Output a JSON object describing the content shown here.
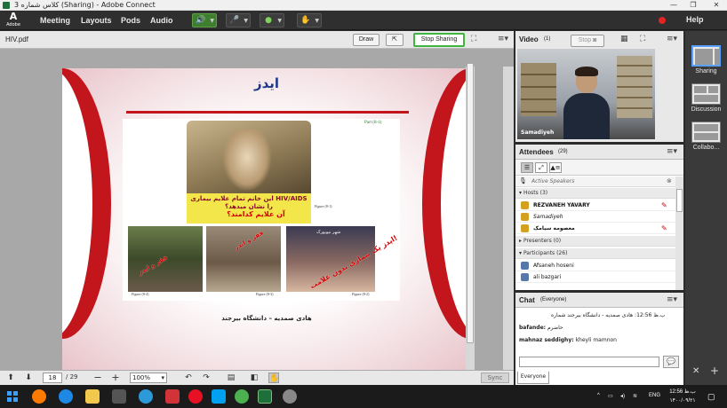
{
  "window": {
    "title": "کلاس شماره 3 (Sharing) - Adobe Connect",
    "controls": [
      "—",
      "❐",
      "✕"
    ]
  },
  "menubar": {
    "logo_text": "Adobe",
    "items": [
      "Meeting",
      "Layouts",
      "Pods",
      "Audio"
    ],
    "help": "Help"
  },
  "share_pod": {
    "title": "HIV.pdf",
    "draw_label": "Draw",
    "stop_sharing_label": "Stop Sharing"
  },
  "slide": {
    "title": "ایدز",
    "part_label": "Part (8-1)",
    "caption_yellow": "این خانم تمام علایم بیماری HIV/AIDS را نشان میدهد؟",
    "caption_red": "آن علایم کدامند؟",
    "figure_top": "Figure (8-1)",
    "photo_b1_text": "فقر و ایدز",
    "photo_b2_text": "فقر و ایدز",
    "photo_b3_text": "ایدز یک بیماری بدون علامت!",
    "photo_b3_top": "شهر نیویورک",
    "figure_b1": "Figure (8-4)",
    "figure_b2": "Figure (8-3)",
    "figure_b3": "Figure (8-2)",
    "footer": "هادی صمدیه – دانشگاه بیرجند"
  },
  "doc_toolbar": {
    "page_current": "18",
    "page_total": "/ 29",
    "zoom": "100%",
    "sync_label": "Sync"
  },
  "video_pod": {
    "title": "Video",
    "count": "(1)",
    "stop_label": "Stop",
    "participant_name": "Samadiyeh"
  },
  "attendees_pod": {
    "title": "Attendees",
    "count": "(29)",
    "active_speakers": "Active Speakers",
    "sections": {
      "hosts": "Hosts (3)",
      "presenters": "Presenters (0)",
      "participants": "Participants (26)"
    },
    "hosts": [
      "REZVANEH YAVARY",
      "Samadiyeh",
      "معصومه سیامک"
    ],
    "participants": [
      "Afsaneh hoseni",
      "ali bazgari"
    ]
  },
  "chat_pod": {
    "title": "Chat",
    "scope": "(Everyone)",
    "messages": [
      {
        "sender": "",
        "text": "ب.ظ 12:56: هادی صمدیه - دانشگاه بیرجند شماره"
      },
      {
        "sender": "bafande:",
        "text": "حاضرم"
      },
      {
        "sender": "mahnaz seddighy:",
        "text": "kheyli mamnon"
      }
    ],
    "tab": "Everyone"
  },
  "layouts_rail": {
    "items": [
      "Sharing",
      "Discussion",
      "Collabo..."
    ]
  },
  "taskbar": {
    "tray_lang": "ENG",
    "time": "12:56 ب.ظ",
    "date": "۱۴۰۰/۰۹/۲۱"
  },
  "colors": {
    "accent_green": "#3fb43f",
    "slide_red": "#c3161c",
    "slide_title_blue": "#1e3a8a"
  }
}
